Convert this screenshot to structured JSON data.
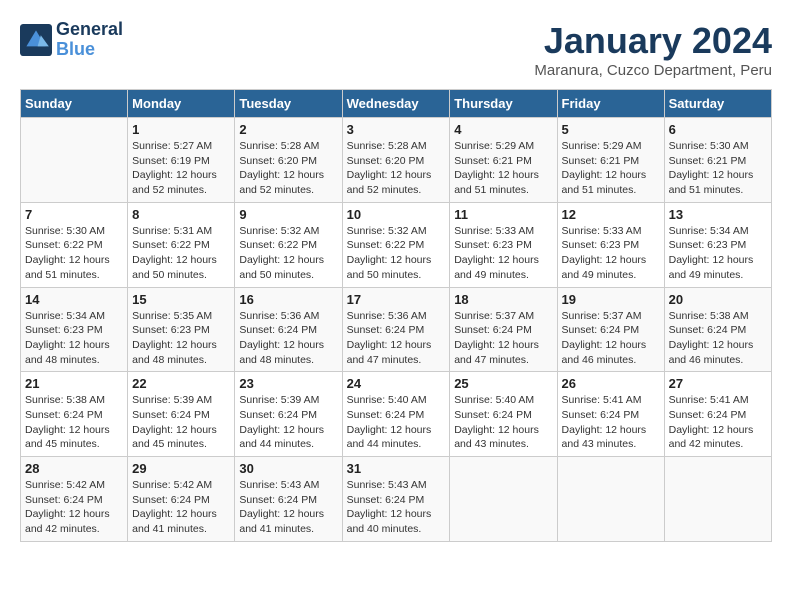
{
  "logo": {
    "line1": "General",
    "line2": "Blue"
  },
  "title": "January 2024",
  "subtitle": "Maranura, Cuzco Department, Peru",
  "days_of_week": [
    "Sunday",
    "Monday",
    "Tuesday",
    "Wednesday",
    "Thursday",
    "Friday",
    "Saturday"
  ],
  "weeks": [
    [
      {
        "day": "",
        "info": ""
      },
      {
        "day": "1",
        "info": "Sunrise: 5:27 AM\nSunset: 6:19 PM\nDaylight: 12 hours\nand 52 minutes."
      },
      {
        "day": "2",
        "info": "Sunrise: 5:28 AM\nSunset: 6:20 PM\nDaylight: 12 hours\nand 52 minutes."
      },
      {
        "day": "3",
        "info": "Sunrise: 5:28 AM\nSunset: 6:20 PM\nDaylight: 12 hours\nand 52 minutes."
      },
      {
        "day": "4",
        "info": "Sunrise: 5:29 AM\nSunset: 6:21 PM\nDaylight: 12 hours\nand 51 minutes."
      },
      {
        "day": "5",
        "info": "Sunrise: 5:29 AM\nSunset: 6:21 PM\nDaylight: 12 hours\nand 51 minutes."
      },
      {
        "day": "6",
        "info": "Sunrise: 5:30 AM\nSunset: 6:21 PM\nDaylight: 12 hours\nand 51 minutes."
      }
    ],
    [
      {
        "day": "7",
        "info": "Sunrise: 5:30 AM\nSunset: 6:22 PM\nDaylight: 12 hours\nand 51 minutes."
      },
      {
        "day": "8",
        "info": "Sunrise: 5:31 AM\nSunset: 6:22 PM\nDaylight: 12 hours\nand 50 minutes."
      },
      {
        "day": "9",
        "info": "Sunrise: 5:32 AM\nSunset: 6:22 PM\nDaylight: 12 hours\nand 50 minutes."
      },
      {
        "day": "10",
        "info": "Sunrise: 5:32 AM\nSunset: 6:22 PM\nDaylight: 12 hours\nand 50 minutes."
      },
      {
        "day": "11",
        "info": "Sunrise: 5:33 AM\nSunset: 6:23 PM\nDaylight: 12 hours\nand 49 minutes."
      },
      {
        "day": "12",
        "info": "Sunrise: 5:33 AM\nSunset: 6:23 PM\nDaylight: 12 hours\nand 49 minutes."
      },
      {
        "day": "13",
        "info": "Sunrise: 5:34 AM\nSunset: 6:23 PM\nDaylight: 12 hours\nand 49 minutes."
      }
    ],
    [
      {
        "day": "14",
        "info": "Sunrise: 5:34 AM\nSunset: 6:23 PM\nDaylight: 12 hours\nand 48 minutes."
      },
      {
        "day": "15",
        "info": "Sunrise: 5:35 AM\nSunset: 6:23 PM\nDaylight: 12 hours\nand 48 minutes."
      },
      {
        "day": "16",
        "info": "Sunrise: 5:36 AM\nSunset: 6:24 PM\nDaylight: 12 hours\nand 48 minutes."
      },
      {
        "day": "17",
        "info": "Sunrise: 5:36 AM\nSunset: 6:24 PM\nDaylight: 12 hours\nand 47 minutes."
      },
      {
        "day": "18",
        "info": "Sunrise: 5:37 AM\nSunset: 6:24 PM\nDaylight: 12 hours\nand 47 minutes."
      },
      {
        "day": "19",
        "info": "Sunrise: 5:37 AM\nSunset: 6:24 PM\nDaylight: 12 hours\nand 46 minutes."
      },
      {
        "day": "20",
        "info": "Sunrise: 5:38 AM\nSunset: 6:24 PM\nDaylight: 12 hours\nand 46 minutes."
      }
    ],
    [
      {
        "day": "21",
        "info": "Sunrise: 5:38 AM\nSunset: 6:24 PM\nDaylight: 12 hours\nand 45 minutes."
      },
      {
        "day": "22",
        "info": "Sunrise: 5:39 AM\nSunset: 6:24 PM\nDaylight: 12 hours\nand 45 minutes."
      },
      {
        "day": "23",
        "info": "Sunrise: 5:39 AM\nSunset: 6:24 PM\nDaylight: 12 hours\nand 44 minutes."
      },
      {
        "day": "24",
        "info": "Sunrise: 5:40 AM\nSunset: 6:24 PM\nDaylight: 12 hours\nand 44 minutes."
      },
      {
        "day": "25",
        "info": "Sunrise: 5:40 AM\nSunset: 6:24 PM\nDaylight: 12 hours\nand 43 minutes."
      },
      {
        "day": "26",
        "info": "Sunrise: 5:41 AM\nSunset: 6:24 PM\nDaylight: 12 hours\nand 43 minutes."
      },
      {
        "day": "27",
        "info": "Sunrise: 5:41 AM\nSunset: 6:24 PM\nDaylight: 12 hours\nand 42 minutes."
      }
    ],
    [
      {
        "day": "28",
        "info": "Sunrise: 5:42 AM\nSunset: 6:24 PM\nDaylight: 12 hours\nand 42 minutes."
      },
      {
        "day": "29",
        "info": "Sunrise: 5:42 AM\nSunset: 6:24 PM\nDaylight: 12 hours\nand 41 minutes."
      },
      {
        "day": "30",
        "info": "Sunrise: 5:43 AM\nSunset: 6:24 PM\nDaylight: 12 hours\nand 41 minutes."
      },
      {
        "day": "31",
        "info": "Sunrise: 5:43 AM\nSunset: 6:24 PM\nDaylight: 12 hours\nand 40 minutes."
      },
      {
        "day": "",
        "info": ""
      },
      {
        "day": "",
        "info": ""
      },
      {
        "day": "",
        "info": ""
      }
    ]
  ]
}
